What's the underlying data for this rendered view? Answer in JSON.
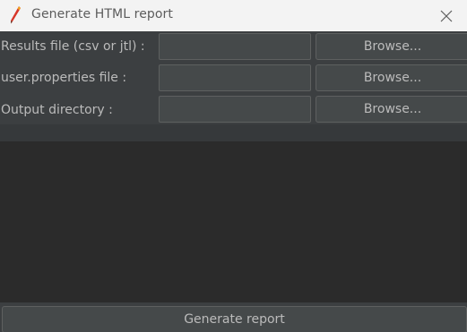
{
  "window": {
    "title": "Generate HTML report",
    "icon": "feather-pen-icon",
    "close_icon": "close-icon"
  },
  "form": {
    "rows": [
      {
        "label": "Results file (csv or jtl) :",
        "value": "",
        "button_label": "Browse..."
      },
      {
        "label": "user.properties file :",
        "value": "",
        "button_label": "Browse..."
      },
      {
        "label": "Output directory :",
        "value": "",
        "button_label": "Browse..."
      }
    ]
  },
  "footer": {
    "generate_label": "Generate report"
  },
  "colors": {
    "background": "#2b2b2b",
    "panel": "#3c3f41",
    "field": "#45494a",
    "border": "#5e6060",
    "text": "#bbbbbb",
    "titlebar": "#f3f3f3"
  }
}
